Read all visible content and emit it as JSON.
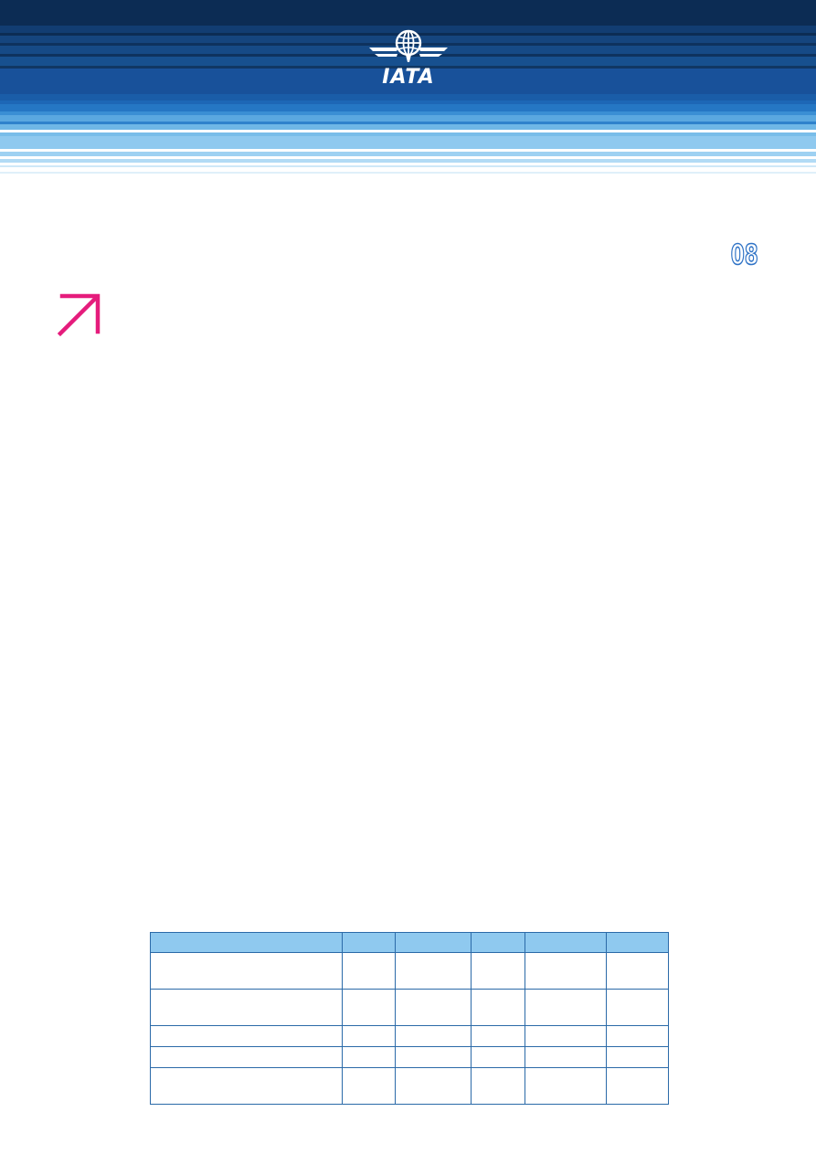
{
  "header": {
    "logo_text": "IATA",
    "logo_icon": "iata-globe-wings-icon",
    "colors": {
      "navy": "#0c2c54",
      "mid_blue": "#1a5da8",
      "light_blue": "#8fc9ef"
    }
  },
  "page": {
    "number": "08"
  },
  "decor": {
    "arrow_icon": "arrow-up-right-icon",
    "arrow_color": "#e51c7c"
  },
  "table": {
    "border_color": "#2b6aa8",
    "header_fill": "#8fc9ef",
    "headers": [
      "",
      "",
      "",
      "",
      "",
      ""
    ],
    "rows": [
      [
        "",
        "",
        "",
        "",
        "",
        ""
      ],
      [
        "",
        "",
        "",
        "",
        "",
        ""
      ],
      [
        "",
        "",
        "",
        "",
        "",
        ""
      ],
      [
        "",
        "",
        "",
        "",
        "",
        ""
      ],
      [
        "",
        "",
        "",
        "",
        "",
        ""
      ]
    ]
  }
}
